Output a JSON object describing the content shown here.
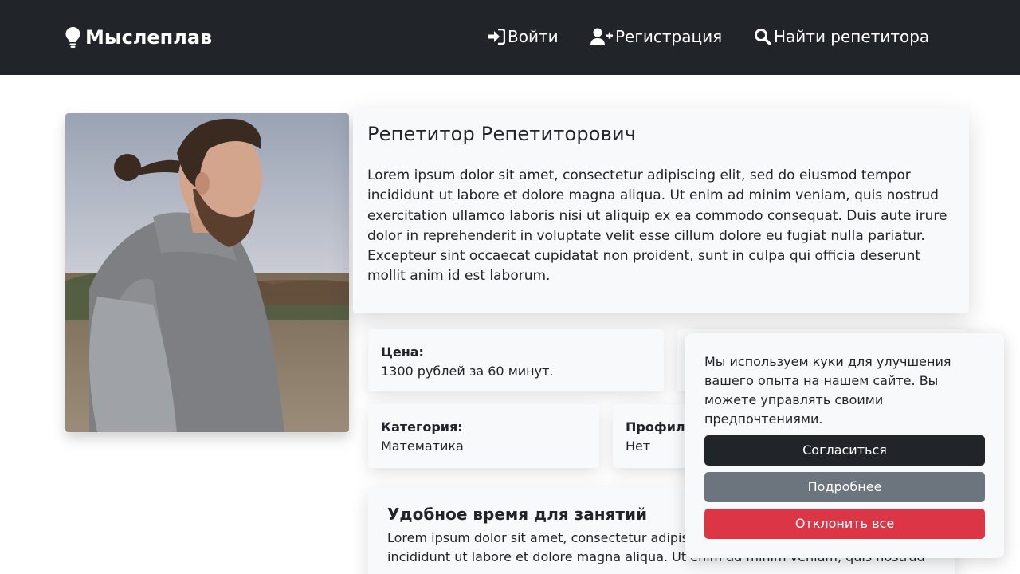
{
  "navbar": {
    "brand": "Мыслеплав",
    "login": "Войти",
    "register": "Регистрация",
    "find_tutor": "Найти репетитора"
  },
  "profile": {
    "name": "Репетитор Репетиторович",
    "bio": "Lorem ipsum dolor sit amet, consectetur adipiscing elit, sed do eiusmod tempor incididunt ut labore et dolore magna aliqua. Ut enim ad minim veniam, quis nostrud exercitation ullamco laboris nisi ut aliquip ex ea commodo consequat. Duis aute irure dolor in reprehenderit in voluptate velit esse cillum dolore eu fugiat nulla pariatur. Excepteur sint occaecat cupidatat non proident, sunt in culpa qui officia deserunt mollit anim id est laborum."
  },
  "details": {
    "price_label": "Цена:",
    "price_value": "1300 рублей за 60 минут.",
    "category_label": "Категория:",
    "category_value": "Математика",
    "profile_label": "Профил",
    "profile_value": "Нет"
  },
  "schedule": {
    "title": "Удобное время для занятий",
    "text": "Lorem ipsum dolor sit amet, consectetur adipiscing elit, sed do eiusmod tempor incididunt ut labore et dolore magna aliqua. Ut enim ad minim veniam, quis nostrud"
  },
  "cookie": {
    "text": "Мы используем куки для улучшения вашего опыта на нашем сайте. Вы можете управлять своими предпочтениями.",
    "accept": "Согласиться",
    "more": "Подробнее",
    "reject": "Отклонить все"
  },
  "colors": {
    "navbar_bg": "#212529",
    "card_bg": "#f8f9fa",
    "accept_btn": "#212529",
    "more_btn": "#6c757d",
    "reject_btn": "#dc3545"
  }
}
